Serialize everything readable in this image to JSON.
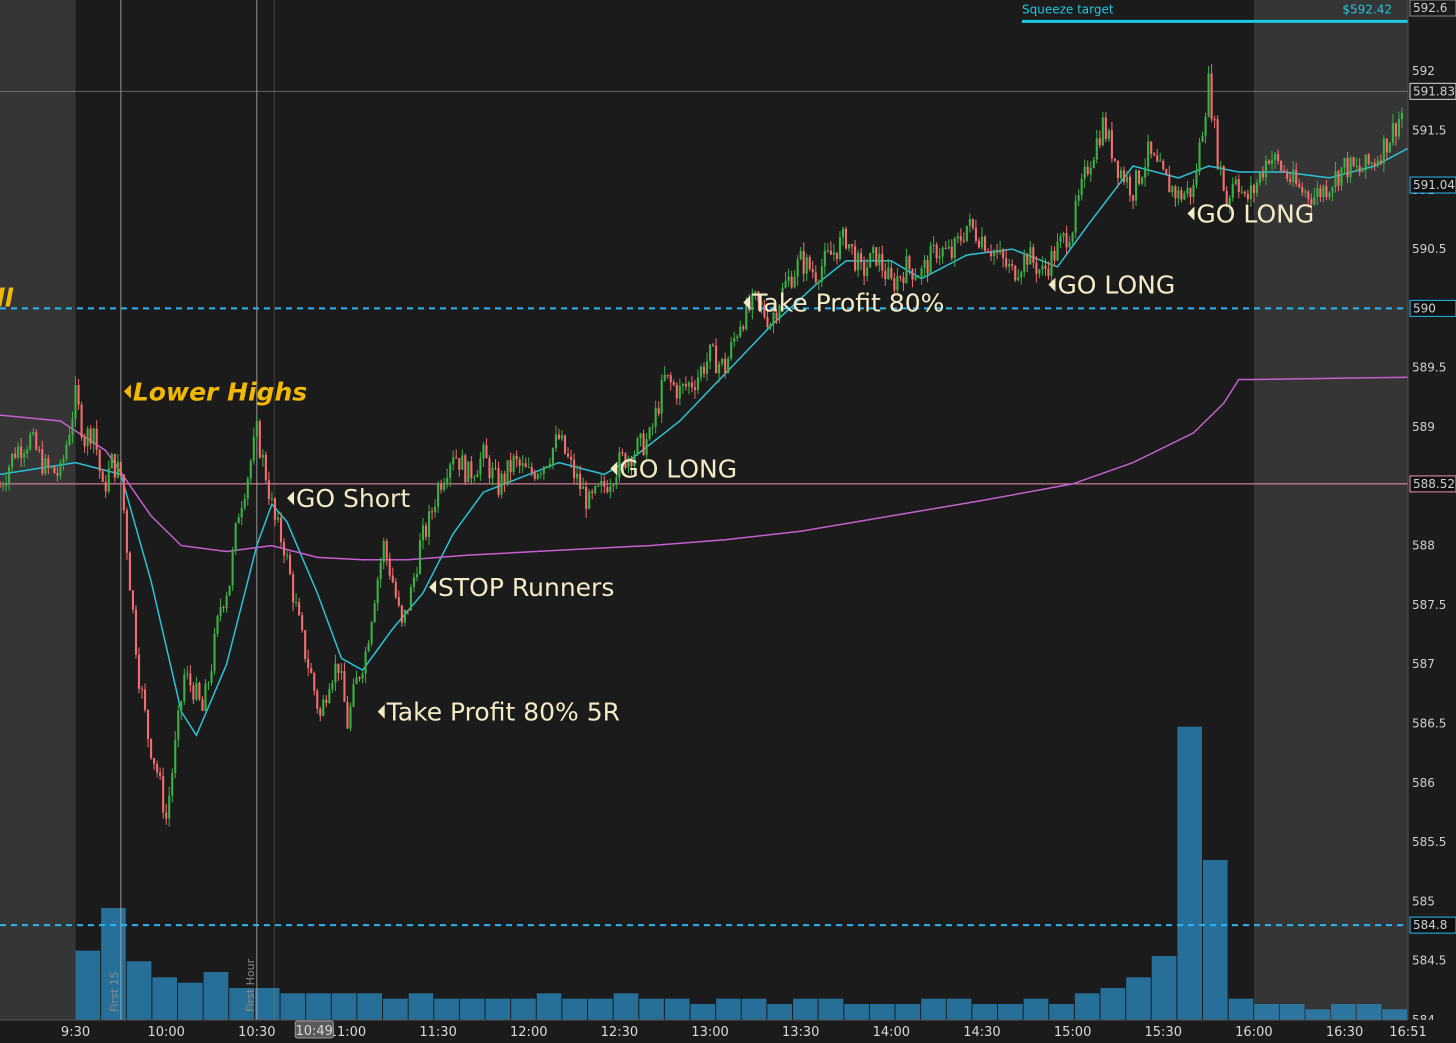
{
  "chart_data": {
    "type": "candlestick",
    "y_axis": {
      "range": [
        584,
        592.6
      ],
      "ticks": [
        584,
        584.5,
        585,
        585.5,
        586,
        586.5,
        587,
        587.5,
        588,
        588.5,
        589,
        589.5,
        590,
        590.5,
        591,
        591.5,
        592,
        592.5
      ]
    },
    "x_axis": {
      "range": [
        "09:05",
        "16:51"
      ],
      "ticks": [
        "9:30",
        "10:00",
        "10:30",
        "11:00",
        "11:30",
        "12:00",
        "12:30",
        "13:00",
        "13:30",
        "14:00",
        "14:30",
        "15:00",
        "15:30",
        "16:00",
        "16:30",
        "16:51"
      ],
      "crosshair_time": "10:49"
    },
    "price_badges": [
      {
        "value": "592.6",
        "color": "#8a8a8a"
      },
      {
        "value": "591.83",
        "color": "#d9d9d9"
      },
      {
        "value": "591.04",
        "color": "#29b6f6"
      },
      {
        "value": "590",
        "color": "#29b6f6"
      },
      {
        "value": "588.52",
        "color": "#f48fb1"
      },
      {
        "value": "584.8",
        "color": "#29b6f6"
      }
    ],
    "horizontal_lines": [
      {
        "price": 590,
        "style": "dashed",
        "color": "#29b6f6"
      },
      {
        "price": 584.8,
        "style": "dashed",
        "color": "#29b6f6"
      },
      {
        "price": 588.52,
        "style": "solid",
        "color": "#f48fb1"
      },
      {
        "price": 591.83,
        "style": "solid",
        "color": "#9a9a9a"
      }
    ],
    "squeeze_target": {
      "label": "Squeeze target",
      "value": "$592.42",
      "price": 592.42,
      "color": "#1ec8e0"
    },
    "vertical_markers": [
      {
        "time": "09:45",
        "label": "First 15"
      },
      {
        "time": "10:30",
        "label": "First Hour"
      }
    ],
    "annotations": [
      {
        "text": "Lower Highs",
        "time": "09:46",
        "price": 589.3,
        "style": "highlight"
      },
      {
        "text": "GO Short",
        "time": "10:40",
        "price": 588.4,
        "style": "normal"
      },
      {
        "text": "STOP Runners",
        "time": "11:27",
        "price": 587.65,
        "style": "normal"
      },
      {
        "text": "Take Profit 80% 5R",
        "time": "11:10",
        "price": 586.6,
        "style": "normal"
      },
      {
        "text": "GO LONG",
        "time": "12:27",
        "price": 588.65,
        "style": "normal"
      },
      {
        "text": "Take Profit 80%",
        "time": "13:11",
        "price": 590.05,
        "style": "normal"
      },
      {
        "text": "GO LONG",
        "time": "14:52",
        "price": 590.2,
        "style": "normal"
      },
      {
        "text": "GO LONG",
        "time": "15:38",
        "price": 590.8,
        "style": "normal"
      }
    ],
    "edge_label": "ll",
    "extended_hours_shading": [
      [
        "09:05",
        "09:30"
      ],
      [
        "16:00",
        "16:51"
      ]
    ],
    "series": [
      {
        "name": "",
        "type": "candles",
        "up_color": "#3cb043",
        "down_color": "#f26d6d",
        "path": [
          [
            "09:05",
            588.5
          ],
          [
            "09:10",
            588.8
          ],
          [
            "09:15",
            588.9
          ],
          [
            "09:20",
            588.65
          ],
          [
            "09:25",
            588.6
          ],
          [
            "09:30",
            589.25
          ],
          [
            "09:33",
            588.9
          ],
          [
            "09:36",
            589.0
          ],
          [
            "09:39",
            588.45
          ],
          [
            "09:42",
            588.7
          ],
          [
            "09:45",
            588.6
          ],
          [
            "09:48",
            587.7
          ],
          [
            "09:51",
            586.9
          ],
          [
            "09:54",
            586.4
          ],
          [
            "09:57",
            586.1
          ],
          [
            "10:00",
            585.7
          ],
          [
            "10:03",
            586.3
          ],
          [
            "10:06",
            586.9
          ],
          [
            "10:09",
            586.8
          ],
          [
            "10:12",
            586.6
          ],
          [
            "10:15",
            587.0
          ],
          [
            "10:18",
            587.5
          ],
          [
            "10:21",
            587.7
          ],
          [
            "10:24",
            588.3
          ],
          [
            "10:27",
            588.6
          ],
          [
            "10:30",
            588.95
          ],
          [
            "10:33",
            588.6
          ],
          [
            "10:36",
            588.2
          ],
          [
            "10:39",
            588.0
          ],
          [
            "10:42",
            587.6
          ],
          [
            "10:45",
            587.2
          ],
          [
            "10:48",
            586.9
          ],
          [
            "10:51",
            586.55
          ],
          [
            "10:54",
            586.9
          ],
          [
            "10:57",
            587.0
          ],
          [
            "11:00",
            586.5
          ],
          [
            "11:03",
            586.85
          ],
          [
            "11:06",
            587.1
          ],
          [
            "11:09",
            587.6
          ],
          [
            "11:12",
            588.0
          ],
          [
            "11:15",
            587.7
          ],
          [
            "11:18",
            587.3
          ],
          [
            "11:21",
            587.6
          ],
          [
            "11:24",
            588.0
          ],
          [
            "11:27",
            588.2
          ],
          [
            "11:30",
            588.5
          ],
          [
            "11:35",
            588.8
          ],
          [
            "11:40",
            588.6
          ],
          [
            "11:45",
            588.75
          ],
          [
            "11:50",
            588.5
          ],
          [
            "11:55",
            588.7
          ],
          [
            "12:00",
            588.6
          ],
          [
            "12:05",
            588.7
          ],
          [
            "12:10",
            588.9
          ],
          [
            "12:15",
            588.6
          ],
          [
            "12:20",
            588.35
          ],
          [
            "12:25",
            588.5
          ],
          [
            "12:30",
            588.7
          ],
          [
            "12:35",
            588.8
          ],
          [
            "12:40",
            588.9
          ],
          [
            "12:45",
            589.4
          ],
          [
            "12:50",
            589.3
          ],
          [
            "12:55",
            589.4
          ],
          [
            "13:00",
            589.6
          ],
          [
            "13:05",
            589.5
          ],
          [
            "13:10",
            589.9
          ],
          [
            "13:15",
            590.05
          ],
          [
            "13:20",
            589.9
          ],
          [
            "13:25",
            590.2
          ],
          [
            "13:30",
            590.4
          ],
          [
            "13:35",
            590.3
          ],
          [
            "13:40",
            590.45
          ],
          [
            "13:45",
            590.6
          ],
          [
            "13:50",
            590.3
          ],
          [
            "13:55",
            590.45
          ],
          [
            "14:00",
            590.2
          ],
          [
            "14:05",
            590.35
          ],
          [
            "14:10",
            590.3
          ],
          [
            "14:15",
            590.5
          ],
          [
            "14:20",
            590.45
          ],
          [
            "14:25",
            590.7
          ],
          [
            "14:30",
            590.6
          ],
          [
            "14:35",
            590.45
          ],
          [
            "14:40",
            590.3
          ],
          [
            "14:45",
            590.45
          ],
          [
            "14:50",
            590.3
          ],
          [
            "14:55",
            590.5
          ],
          [
            "15:00",
            590.7
          ],
          [
            "15:05",
            591.2
          ],
          [
            "15:10",
            591.55
          ],
          [
            "15:15",
            591.2
          ],
          [
            "15:20",
            591.0
          ],
          [
            "15:25",
            591.3
          ],
          [
            "15:30",
            591.1
          ],
          [
            "15:35",
            590.95
          ],
          [
            "15:40",
            591.0
          ],
          [
            "15:45",
            591.9
          ],
          [
            "15:48",
            591.3
          ],
          [
            "15:51",
            590.9
          ],
          [
            "15:54",
            591.15
          ],
          [
            "15:57",
            590.9
          ],
          [
            "16:00",
            591.0
          ],
          [
            "16:05",
            591.3
          ],
          [
            "16:10",
            591.15
          ],
          [
            "16:15",
            591.0
          ],
          [
            "16:20",
            590.95
          ],
          [
            "16:25",
            591.05
          ],
          [
            "16:30",
            591.2
          ],
          [
            "16:35",
            591.15
          ],
          [
            "16:40",
            591.25
          ],
          [
            "16:45",
            591.45
          ],
          [
            "16:50",
            591.7
          ]
        ]
      },
      {
        "name": "",
        "type": "line",
        "color": "#29c3d8",
        "points": [
          [
            "09:05",
            588.6
          ],
          [
            "09:30",
            588.7
          ],
          [
            "09:45",
            588.6
          ],
          [
            "09:55",
            587.7
          ],
          [
            "10:05",
            586.6
          ],
          [
            "10:10",
            586.4
          ],
          [
            "10:20",
            587.0
          ],
          [
            "10:30",
            588.0
          ],
          [
            "10:35",
            588.35
          ],
          [
            "10:40",
            588.2
          ],
          [
            "10:50",
            587.6
          ],
          [
            "10:58",
            587.05
          ],
          [
            "11:05",
            586.95
          ],
          [
            "11:15",
            587.3
          ],
          [
            "11:25",
            587.6
          ],
          [
            "11:35",
            588.1
          ],
          [
            "11:45",
            588.45
          ],
          [
            "12:00",
            588.6
          ],
          [
            "12:10",
            588.7
          ],
          [
            "12:25",
            588.6
          ],
          [
            "12:35",
            588.75
          ],
          [
            "12:50",
            589.05
          ],
          [
            "13:05",
            589.45
          ],
          [
            "13:20",
            589.85
          ],
          [
            "13:35",
            590.2
          ],
          [
            "13:45",
            590.4
          ],
          [
            "14:00",
            590.4
          ],
          [
            "14:10",
            590.25
          ],
          [
            "14:25",
            590.45
          ],
          [
            "14:40",
            590.5
          ],
          [
            "14:55",
            590.35
          ],
          [
            "15:05",
            590.7
          ],
          [
            "15:20",
            591.2
          ],
          [
            "15:35",
            591.1
          ],
          [
            "15:45",
            591.2
          ],
          [
            "15:55",
            591.15
          ],
          [
            "16:10",
            591.15
          ],
          [
            "16:25",
            591.1
          ],
          [
            "16:40",
            591.2
          ],
          [
            "16:51",
            591.35
          ]
        ]
      },
      {
        "name": "",
        "type": "line",
        "color": "#c65fd0",
        "points": [
          [
            "09:05",
            589.1
          ],
          [
            "09:25",
            589.05
          ],
          [
            "09:40",
            588.8
          ],
          [
            "09:55",
            588.25
          ],
          [
            "10:05",
            588.0
          ],
          [
            "10:20",
            587.95
          ],
          [
            "10:35",
            588.0
          ],
          [
            "10:50",
            587.9
          ],
          [
            "11:05",
            587.88
          ],
          [
            "11:20",
            587.88
          ],
          [
            "11:40",
            587.92
          ],
          [
            "12:10",
            587.96
          ],
          [
            "12:40",
            588.0
          ],
          [
            "13:05",
            588.05
          ],
          [
            "13:30",
            588.12
          ],
          [
            "14:00",
            588.25
          ],
          [
            "14:30",
            588.38
          ],
          [
            "15:00",
            588.52
          ],
          [
            "15:20",
            588.7
          ],
          [
            "15:40",
            588.95
          ],
          [
            "15:50",
            589.2
          ],
          [
            "15:55",
            589.4
          ],
          [
            "16:00",
            589.4
          ],
          [
            "16:51",
            589.42
          ]
        ]
      },
      {
        "name": "",
        "type": "volume",
        "color": "#2b8cc4",
        "values": [
          13,
          21,
          11,
          8,
          7,
          9,
          6,
          6,
          5,
          5,
          5,
          5,
          4,
          5,
          4,
          4,
          4,
          4,
          5,
          4,
          4,
          5,
          4,
          4,
          3,
          4,
          4,
          3,
          4,
          4,
          3,
          3,
          3,
          4,
          4,
          3,
          3,
          4,
          3,
          5,
          6,
          8,
          12,
          55,
          30,
          4,
          3,
          3,
          2,
          3,
          3,
          2
        ]
      }
    ]
  }
}
